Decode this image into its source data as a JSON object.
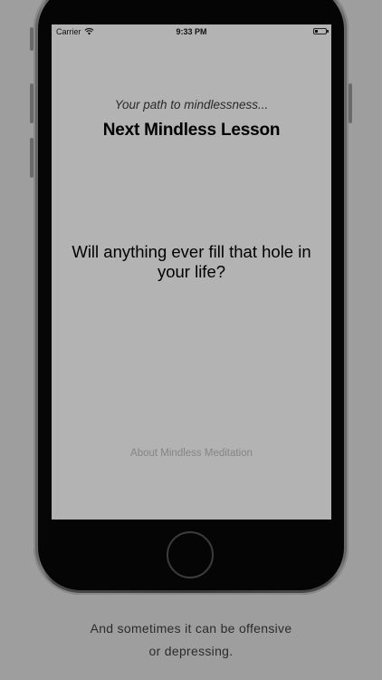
{
  "status_bar": {
    "carrier": "Carrier",
    "time": "9:33 PM",
    "wifi_icon": "wifi-icon",
    "battery_icon": "battery-icon"
  },
  "screen": {
    "tagline": "Your path to mindlessness...",
    "title": "Next Mindless Lesson",
    "lesson_text": "Will anything ever fill that hole in your life?",
    "about_link": "About Mindless Meditation"
  },
  "caption": {
    "line1": "And sometimes it can be offensive",
    "line2": "or depressing."
  },
  "colors": {
    "page_background": "#9e9e9e",
    "screen_background": "#b3b3b3",
    "link_color": "#858585"
  }
}
